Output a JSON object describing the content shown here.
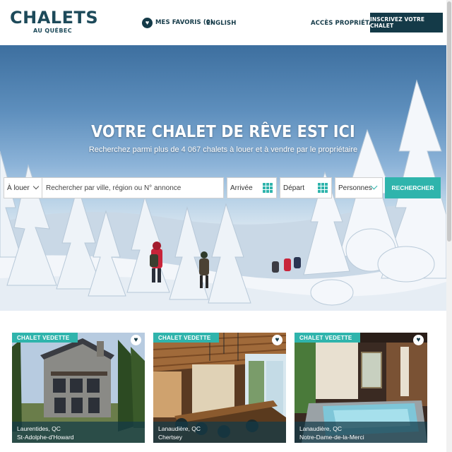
{
  "header": {
    "logo_main": "CHALETS",
    "logo_sub": "AU QUÉBEC",
    "favorites_label": "MES FAVORIS (0)",
    "language_label": "ENGLISH",
    "owner_access_label": "ACCÈS PROPRIÉTAIRE",
    "register_button_label": "INSCRIVEZ VOTRE CHALET"
  },
  "hero": {
    "title": "VOTRE CHALET DE RÊVE EST ICI",
    "subtitle": "Recherchez parmi plus de 4 067 chalets à louer et à vendre par le propriétaire"
  },
  "search": {
    "type_value": "À louer",
    "query_placeholder": "Rechercher par ville, région ou N° annonce",
    "arrival_placeholder": "Arrivée",
    "departure_placeholder": "Départ",
    "persons_value": "Personnes",
    "submit_label": "RECHERCHER"
  },
  "listings": [
    {
      "badge": "CHALET VEDETTE",
      "region": "Laurentides, QC",
      "town": "St-Adolphe-d'Howard"
    },
    {
      "badge": "CHALET VEDETTE",
      "region": "Lanaudière, QC",
      "town": "Chertsey"
    },
    {
      "badge": "CHALET VEDETTE",
      "region": "Lanaudière, QC",
      "town": "Notre-Dame-de-la-Merci"
    }
  ],
  "colors": {
    "brand_dark": "#143a48",
    "brand_teal": "#2fb4ac"
  }
}
